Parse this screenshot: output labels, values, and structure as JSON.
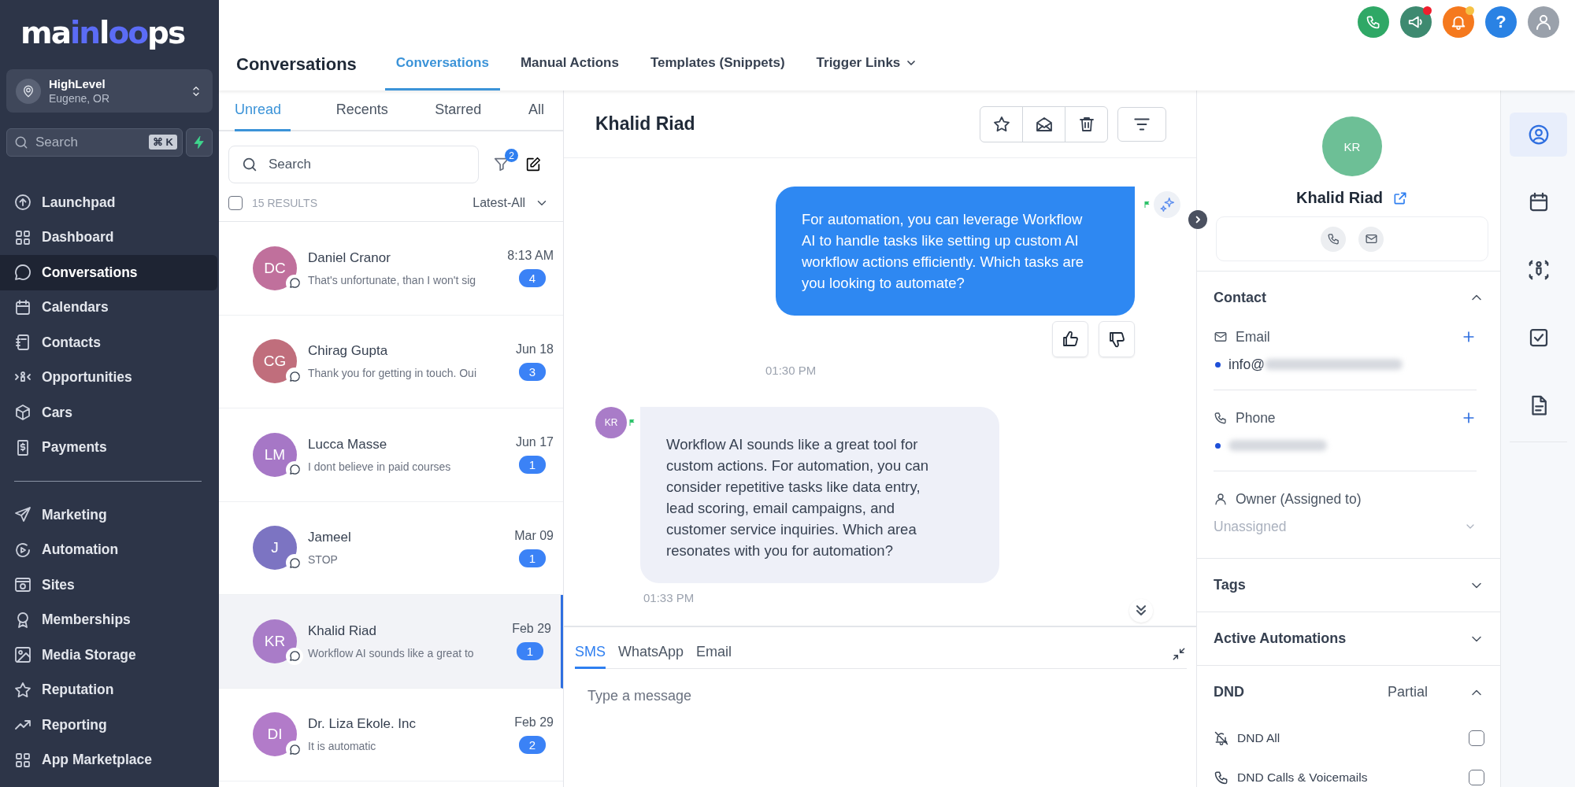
{
  "sidebar": {
    "logo": "ma**in**l**oo**ps",
    "account": {
      "name": "HighLevel",
      "location": "Eugene, OR"
    },
    "search": {
      "placeholder": "Search",
      "shortcut": "⌘ K"
    },
    "nav_primary": [
      {
        "label": "Launchpad",
        "selected": false
      },
      {
        "label": "Dashboard",
        "selected": false
      },
      {
        "label": "Conversations",
        "selected": true
      },
      {
        "label": "Calendars",
        "selected": false
      },
      {
        "label": "Contacts",
        "selected": false
      },
      {
        "label": "Opportunities",
        "selected": false
      },
      {
        "label": "Cars",
        "selected": false
      },
      {
        "label": "Payments",
        "selected": false
      }
    ],
    "nav_secondary": [
      {
        "label": "Marketing",
        "selected": false
      },
      {
        "label": "Automation",
        "selected": false
      },
      {
        "label": "Sites",
        "selected": false
      },
      {
        "label": "Memberships",
        "selected": false
      },
      {
        "label": "Media Storage",
        "selected": false
      },
      {
        "label": "Reputation",
        "selected": false
      },
      {
        "label": "Reporting",
        "selected": false
      },
      {
        "label": "App Marketplace",
        "selected": false
      }
    ]
  },
  "header": {
    "title": "Conversations",
    "help": "?",
    "announcements_unread": true,
    "notifications_unread": true,
    "tabs": [
      {
        "label": "Conversations",
        "selected": true,
        "has_menu": false
      },
      {
        "label": "Manual Actions",
        "selected": false,
        "has_menu": false
      },
      {
        "label": "Templates (Snippets)",
        "selected": false,
        "has_menu": false
      },
      {
        "label": "Trigger Links",
        "selected": false,
        "has_menu": true
      }
    ]
  },
  "conversations": {
    "tabs": [
      {
        "label": "Unread",
        "selected": true
      },
      {
        "label": "Recents",
        "selected": false
      },
      {
        "label": "Starred",
        "selected": false
      },
      {
        "label": "All",
        "selected": false
      }
    ],
    "search": {
      "placeholder": "Search"
    },
    "filter_count": "2",
    "select_all_checked": false,
    "results": "15 RESULTS",
    "sort": "Latest-All",
    "items": [
      {
        "initials": "DC",
        "color": "#c0709c",
        "name": "Daniel Cranor",
        "preview": "That's unfortunate, than I won't sig",
        "time": "8:13 AM",
        "unread": "4",
        "selected": false
      },
      {
        "initials": "CG",
        "color": "#c06e7c",
        "name": "Chirag Gupta",
        "preview": "Thank you for getting in touch. Oui",
        "time": "Jun 18",
        "unread": "3",
        "selected": false
      },
      {
        "initials": "LM",
        "color": "#a677c6",
        "name": "Lucca Masse",
        "preview": "I dont believe in paid courses",
        "time": "Jun 17",
        "unread": "1",
        "selected": false
      },
      {
        "initials": "J",
        "color": "#7c74c2",
        "name": "Jameel",
        "preview": "STOP",
        "time": "Mar 09",
        "unread": "1",
        "selected": false
      },
      {
        "initials": "KR",
        "color": "#a97cc8",
        "name": "Khalid Riad",
        "preview": "Workflow AI sounds like a great to",
        "time": "Feb 29",
        "unread": "1",
        "selected": true
      },
      {
        "initials": "DI",
        "color": "#b27bc9",
        "name": "Dr. Liza Ekole. Inc",
        "preview": "It is automatic",
        "time": "Feb 29",
        "unread": "2",
        "selected": false
      }
    ]
  },
  "chat": {
    "contact_name": "Khalid Riad",
    "messages": [
      {
        "kind": "outgoing",
        "text": "For automation, you can leverage Workflow AI to handle tasks like setting up custom AI workflow actions efficiently. Which tasks are you looking to automate?",
        "time": "01:30 PM"
      },
      {
        "kind": "incoming",
        "initials": "KR",
        "text": "Workflow AI sounds like a great tool for custom actions. For automation, you can consider repetitive tasks like data entry, lead scoring, email campaigns, and customer service inquiries. Which area resonates with you for automation?",
        "time": "01:33 PM"
      }
    ],
    "composer": {
      "tabs": [
        {
          "label": "SMS",
          "selected": true
        },
        {
          "label": "WhatsApp",
          "selected": false
        },
        {
          "label": "Email",
          "selected": false
        }
      ],
      "placeholder": "Type a message"
    }
  },
  "contact": {
    "initials": "KR",
    "name": "Khalid Riad",
    "sections": [
      {
        "kind": "contact",
        "title": "Contact",
        "expanded": true,
        "email_label": "Email",
        "email_value": "info@",
        "phone_label": "Phone",
        "owner_label": "Owner (Assigned to)",
        "owner_placeholder": "Unassigned"
      },
      {
        "kind": "plain",
        "title": "Tags",
        "expanded": false
      },
      {
        "kind": "plain",
        "title": "Active Automations",
        "expanded": false
      },
      {
        "kind": "dnd",
        "title": "DND",
        "status": "Partial",
        "expanded": true,
        "options": [
          {
            "label": "DND All",
            "checked": false
          },
          {
            "label": "DND Calls & Voicemails",
            "checked": false
          }
        ]
      }
    ]
  },
  "rail": [
    {
      "selected": true
    },
    {
      "selected": false
    },
    {
      "selected": false
    },
    {
      "selected": false
    },
    {
      "selected": false
    }
  ]
}
